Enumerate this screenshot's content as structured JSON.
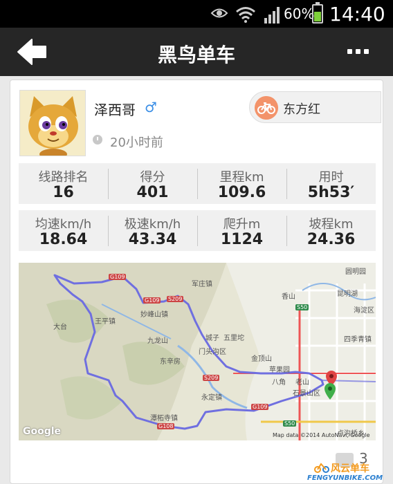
{
  "status_bar": {
    "battery_percent": "60%",
    "time": "14:40",
    "icons": [
      "eye-icon",
      "wifi-icon",
      "signal-icon",
      "battery-icon"
    ]
  },
  "header": {
    "title": "黑鸟单车",
    "back_icon": "arrow-left-icon",
    "more_icon": "more-dots-icon"
  },
  "user": {
    "name": "泽西哥",
    "gender_symbol": "♂",
    "time_ago": "20小时前"
  },
  "team": {
    "name": "东方红",
    "icon": "bicycle-icon",
    "icon_color": "#f3936a"
  },
  "stats_row1": [
    {
      "label": "线路排名",
      "value": "16"
    },
    {
      "label": "得分",
      "value": "401"
    },
    {
      "label": "里程km",
      "value": "109.6"
    },
    {
      "label": "用时",
      "value": "5h53′"
    }
  ],
  "stats_row2": [
    {
      "label": "均速km/h",
      "value": "18.64"
    },
    {
      "label": "极速km/h",
      "value": "43.34"
    },
    {
      "label": "爬升m",
      "value": "1124"
    },
    {
      "label": "坡程km",
      "value": "24.36"
    }
  ],
  "map": {
    "labels": [
      "大台",
      "王平镇",
      "妙峰山镇",
      "九龙山",
      "东辛房",
      "军庄镇",
      "城子",
      "五里坨",
      "门头沟区",
      "金顶山",
      "苹果园",
      "八角",
      "老山",
      "石景山区",
      "永定镇",
      "潭柘寺镇",
      "香山",
      "圆明园",
      "昆明湖",
      "海淀区",
      "四季青镇",
      "卢沟桥乡"
    ],
    "road_badges": [
      "G109",
      "G109",
      "S209",
      "S209",
      "G109",
      "S50",
      "S50",
      "G108"
    ],
    "google": "Google",
    "credit": "Map data ©2014 AutoNavi, Google",
    "route_color": "#6f6fe0",
    "start_pin_color": "#e04444",
    "end_pin_color": "#3fae49"
  },
  "comments": {
    "count": "3"
  },
  "watermark": {
    "name": "风云单车",
    "site": "FENGYUNBIKE.COM"
  }
}
